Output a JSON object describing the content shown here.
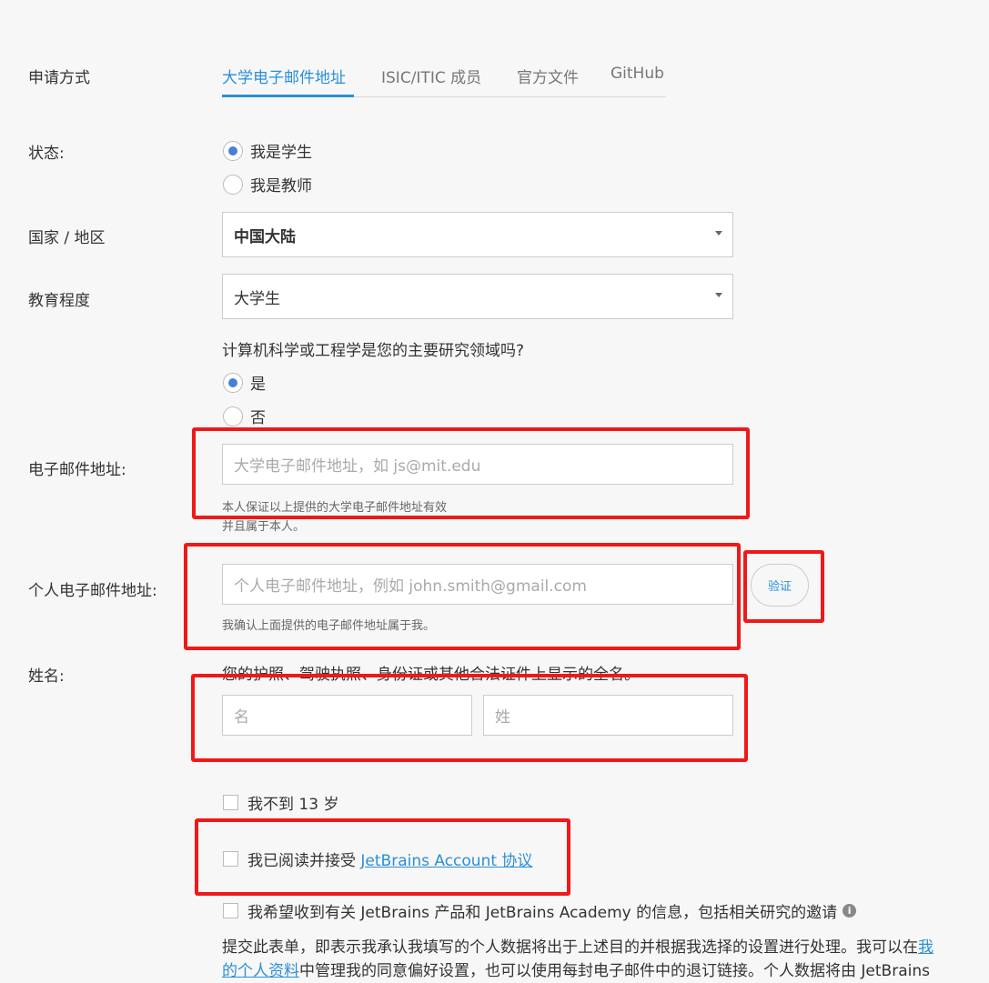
{
  "application_method": {
    "label": "申请方式",
    "tabs": [
      "大学电子邮件地址",
      "ISIC/ITIC 成员",
      "官方文件",
      "GitHub"
    ],
    "active_tab": 0
  },
  "status": {
    "label": "状态:",
    "options": [
      "我是学生",
      "我是教师"
    ],
    "selected": 0
  },
  "country": {
    "label": "国家 / 地区",
    "value": "中国大陆"
  },
  "education": {
    "label": "教育程度",
    "value": "大学生"
  },
  "major_question": {
    "text": "计算机科学或工程学是您的主要研究领域吗?",
    "options": [
      "是",
      "否"
    ],
    "selected": 0
  },
  "university_email": {
    "label": "电子邮件地址:",
    "placeholder": "大学电子邮件地址，如 js@mit.edu",
    "hint_line1": "本人保证以上提供的大学电子邮件地址有效",
    "hint_line2": "并且属于本人。"
  },
  "personal_email": {
    "label": "个人电子邮件地址:",
    "placeholder": "个人电子邮件地址，例如 john.smith@gmail.com",
    "hint": "我确认上面提供的电子邮件地址属于我。",
    "verify_label": "验证"
  },
  "name": {
    "label": "姓名:",
    "hint": "您的护照、驾驶执照、身份证或其他合法证件上显示的全名。",
    "first_placeholder": "名",
    "last_placeholder": "姓"
  },
  "checkboxes": {
    "under13": "我不到 13 岁",
    "agree_prefix": "我已阅读并接受 ",
    "agree_link": "JetBrains Account 协议",
    "newsletter": "我希望收到有关 JetBrains 产品和 JetBrains Academy 的信息，包括相关研究的邀请"
  },
  "consent": {
    "line1_text": "提交此表单，即表示我承认我填写的个人数据将出于上述目的并根据我选择的设置进行处理。我可以在",
    "line1_link": "我",
    "line2_link": "的个人资料",
    "line2_text": "中管理我的同意偏好设置，也可以使用每封电子邮件中的退订链接。个人数据将由 JetBrains"
  },
  "colors": {
    "accent": "#2a8fd8",
    "annotation_red": "#f01818",
    "radio_fill": "#4a7fd6",
    "background": "#f7f7f7"
  }
}
